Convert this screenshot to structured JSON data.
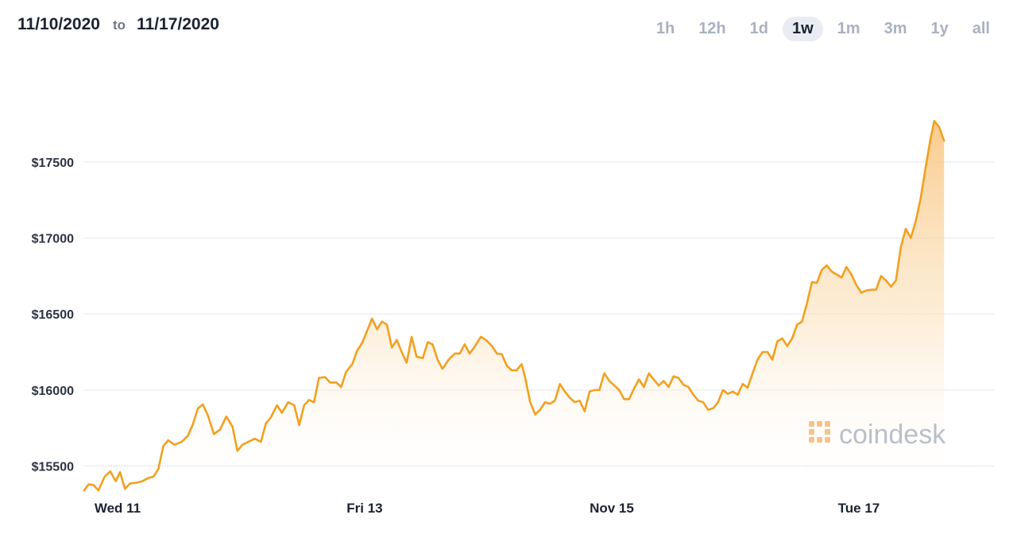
{
  "range": {
    "start": "11/10/2020",
    "to": "to",
    "end": "11/17/2020"
  },
  "timeframes": [
    {
      "label": "1h",
      "active": false
    },
    {
      "label": "12h",
      "active": false
    },
    {
      "label": "1d",
      "active": false
    },
    {
      "label": "1w",
      "active": true
    },
    {
      "label": "1m",
      "active": false
    },
    {
      "label": "3m",
      "active": false
    },
    {
      "label": "1y",
      "active": false
    },
    {
      "label": "all",
      "active": false
    }
  ],
  "watermark": "coindesk",
  "colors": {
    "line": "#f2a01f",
    "fill_top": "#f8c27a",
    "grid": "#c8ccd8",
    "active_tab_bg": "#e9ecf2"
  },
  "chart_data": {
    "type": "area",
    "xlabel": "",
    "ylabel": "",
    "ylim": [
      15325,
      17980
    ],
    "xlim": [
      0,
      7.37
    ],
    "yticks": [
      {
        "value": 15500,
        "label": "$15500"
      },
      {
        "value": 16000,
        "label": "$16000"
      },
      {
        "value": 16500,
        "label": "$16500"
      },
      {
        "value": 17000,
        "label": "$17000"
      },
      {
        "value": 17500,
        "label": "$17500"
      }
    ],
    "xticks": [
      {
        "value": 0.27,
        "label": "Wed 11"
      },
      {
        "value": 2.27,
        "label": "Fri 13"
      },
      {
        "value": 4.27,
        "label": "Nov 15"
      },
      {
        "value": 6.27,
        "label": "Tue 17"
      }
    ],
    "grid": true,
    "series": [
      {
        "values": [
          [
            0.0,
            15340
          ],
          [
            0.035,
            15380
          ],
          [
            0.075,
            15375
          ],
          [
            0.115,
            15340
          ],
          [
            0.165,
            15430
          ],
          [
            0.21,
            15465
          ],
          [
            0.255,
            15400
          ],
          [
            0.29,
            15460
          ],
          [
            0.33,
            15350
          ],
          [
            0.37,
            15385
          ],
          [
            0.42,
            15390
          ],
          [
            0.47,
            15400
          ],
          [
            0.515,
            15420
          ],
          [
            0.56,
            15430
          ],
          [
            0.6,
            15480
          ],
          [
            0.64,
            15630
          ],
          [
            0.68,
            15670
          ],
          [
            0.73,
            15640
          ],
          [
            0.79,
            15660
          ],
          [
            0.84,
            15700
          ],
          [
            0.88,
            15775
          ],
          [
            0.92,
            15880
          ],
          [
            0.96,
            15905
          ],
          [
            1.0,
            15835
          ],
          [
            1.05,
            15710
          ],
          [
            1.1,
            15740
          ],
          [
            1.15,
            15825
          ],
          [
            1.2,
            15760
          ],
          [
            1.24,
            15600
          ],
          [
            1.28,
            15640
          ],
          [
            1.33,
            15660
          ],
          [
            1.38,
            15680
          ],
          [
            1.43,
            15660
          ],
          [
            1.47,
            15780
          ],
          [
            1.51,
            15820
          ],
          [
            1.56,
            15900
          ],
          [
            1.6,
            15850
          ],
          [
            1.65,
            15920
          ],
          [
            1.7,
            15900
          ],
          [
            1.74,
            15770
          ],
          [
            1.78,
            15900
          ],
          [
            1.82,
            15935
          ],
          [
            1.86,
            15920
          ],
          [
            1.9,
            16080
          ],
          [
            1.95,
            16085
          ],
          [
            1.99,
            16050
          ],
          [
            2.04,
            16050
          ],
          [
            2.08,
            16020
          ],
          [
            2.12,
            16120
          ],
          [
            2.17,
            16170
          ],
          [
            2.21,
            16260
          ],
          [
            2.25,
            16310
          ],
          [
            2.29,
            16390
          ],
          [
            2.33,
            16470
          ],
          [
            2.37,
            16400
          ],
          [
            2.41,
            16450
          ],
          [
            2.45,
            16430
          ],
          [
            2.49,
            16280
          ],
          [
            2.53,
            16330
          ],
          [
            2.57,
            16250
          ],
          [
            2.61,
            16180
          ],
          [
            2.65,
            16350
          ],
          [
            2.69,
            16220
          ],
          [
            2.74,
            16210
          ],
          [
            2.78,
            16315
          ],
          [
            2.82,
            16300
          ],
          [
            2.86,
            16200
          ],
          [
            2.9,
            16140
          ],
          [
            2.95,
            16200
          ],
          [
            3.0,
            16240
          ],
          [
            3.04,
            16240
          ],
          [
            3.08,
            16300
          ],
          [
            3.12,
            16240
          ],
          [
            3.16,
            16285
          ],
          [
            3.21,
            16350
          ],
          [
            3.25,
            16330
          ],
          [
            3.3,
            16290
          ],
          [
            3.34,
            16240
          ],
          [
            3.38,
            16235
          ],
          [
            3.42,
            16160
          ],
          [
            3.46,
            16130
          ],
          [
            3.5,
            16130
          ],
          [
            3.54,
            16170
          ],
          [
            3.57,
            16080
          ],
          [
            3.61,
            15920
          ],
          [
            3.65,
            15840
          ],
          [
            3.69,
            15870
          ],
          [
            3.73,
            15920
          ],
          [
            3.77,
            15910
          ],
          [
            3.81,
            15930
          ],
          [
            3.85,
            16040
          ],
          [
            3.89,
            15990
          ],
          [
            3.93,
            15950
          ],
          [
            3.97,
            15920
          ],
          [
            4.01,
            15930
          ],
          [
            4.05,
            15860
          ],
          [
            4.09,
            15990
          ],
          [
            4.13,
            16000
          ],
          [
            4.17,
            16000
          ],
          [
            4.21,
            16110
          ],
          [
            4.25,
            16060
          ],
          [
            4.29,
            16030
          ],
          [
            4.33,
            16000
          ],
          [
            4.37,
            15940
          ],
          [
            4.41,
            15940
          ],
          [
            4.45,
            16010
          ],
          [
            4.49,
            16070
          ],
          [
            4.53,
            16020
          ],
          [
            4.57,
            16110
          ],
          [
            4.61,
            16070
          ],
          [
            4.65,
            16030
          ],
          [
            4.69,
            16060
          ],
          [
            4.73,
            16020
          ],
          [
            4.77,
            16090
          ],
          [
            4.81,
            16080
          ],
          [
            4.85,
            16035
          ],
          [
            4.89,
            16020
          ],
          [
            4.93,
            15970
          ],
          [
            4.97,
            15930
          ],
          [
            5.01,
            15920
          ],
          [
            5.05,
            15870
          ],
          [
            5.09,
            15880
          ],
          [
            5.13,
            15920
          ],
          [
            5.17,
            16000
          ],
          [
            5.21,
            15975
          ],
          [
            5.25,
            15990
          ],
          [
            5.29,
            15970
          ],
          [
            5.33,
            16040
          ],
          [
            5.37,
            16015
          ],
          [
            5.41,
            16110
          ],
          [
            5.45,
            16200
          ],
          [
            5.49,
            16250
          ],
          [
            5.53,
            16250
          ],
          [
            5.57,
            16200
          ],
          [
            5.61,
            16320
          ],
          [
            5.65,
            16340
          ],
          [
            5.69,
            16290
          ],
          [
            5.73,
            16340
          ],
          [
            5.77,
            16430
          ],
          [
            5.81,
            16450
          ],
          [
            5.85,
            16570
          ],
          [
            5.89,
            16710
          ],
          [
            5.93,
            16705
          ],
          [
            5.97,
            16790
          ],
          [
            6.01,
            16820
          ],
          [
            6.05,
            16780
          ],
          [
            6.09,
            16760
          ],
          [
            6.13,
            16740
          ],
          [
            6.17,
            16810
          ],
          [
            6.21,
            16760
          ],
          [
            6.25,
            16690
          ],
          [
            6.29,
            16640
          ],
          [
            6.33,
            16655
          ],
          [
            6.37,
            16660
          ],
          [
            6.41,
            16660
          ],
          [
            6.45,
            16750
          ],
          [
            6.49,
            16720
          ],
          [
            6.53,
            16680
          ],
          [
            6.57,
            16720
          ],
          [
            6.61,
            16940
          ],
          [
            6.65,
            17060
          ],
          [
            6.69,
            17000
          ],
          [
            6.73,
            17110
          ],
          [
            6.77,
            17260
          ],
          [
            6.81,
            17460
          ],
          [
            6.85,
            17650
          ],
          [
            6.88,
            17770
          ],
          [
            6.92,
            17730
          ],
          [
            6.96,
            17640
          ]
        ]
      }
    ]
  }
}
